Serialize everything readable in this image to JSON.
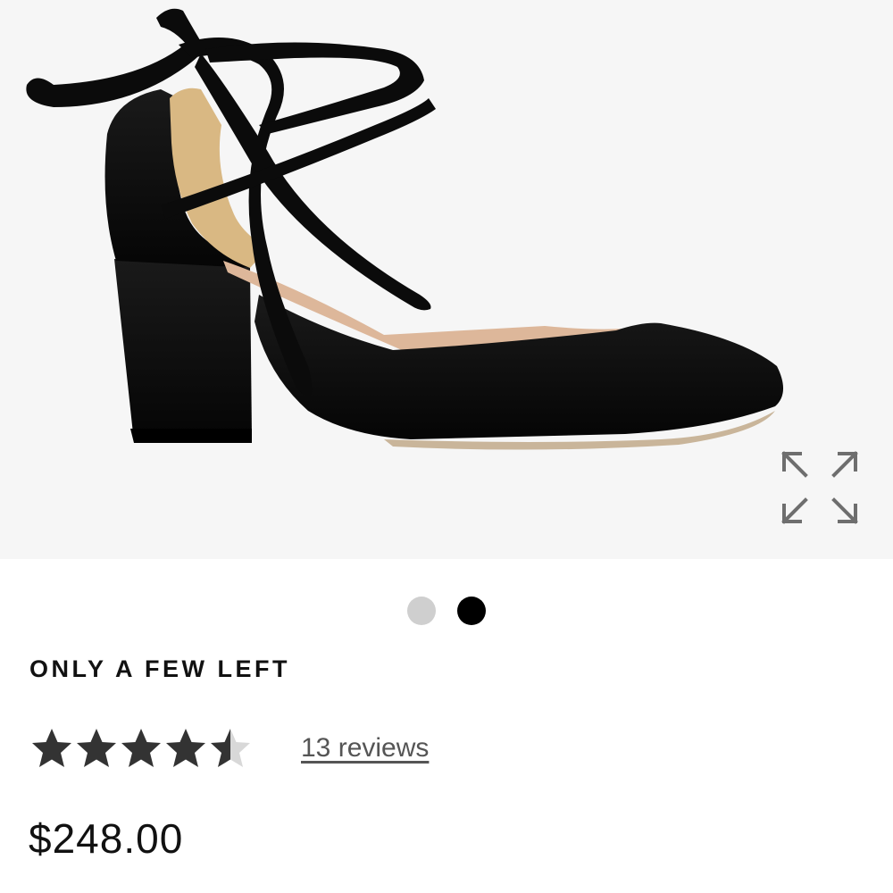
{
  "product": {
    "image_alt": "black suede block heel with ankle ties",
    "stock_status": "ONLY A FEW LEFT",
    "rating": 4.5,
    "rating_max": 5,
    "reviews_link": "13 reviews",
    "price": "$248.00"
  },
  "carousel": {
    "slide_count": 2,
    "active_index": 1
  },
  "icons": {
    "expand": "expand-arrows-icon",
    "star": "star-icon"
  },
  "colors": {
    "image_background": "#f6f6f6",
    "star_filled": "#333333",
    "star_empty": "#d8d8d8",
    "dot_active": "#000000",
    "dot_inactive": "#cfcfcf"
  }
}
